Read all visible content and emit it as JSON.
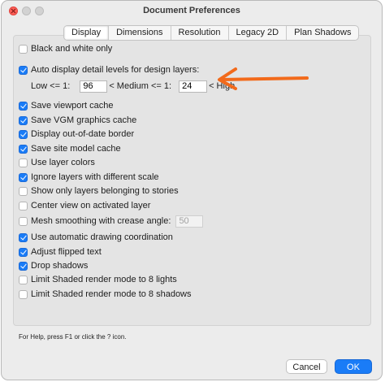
{
  "window": {
    "title": "Document Preferences"
  },
  "tabs": [
    {
      "label": "Display",
      "active": true
    },
    {
      "label": "Dimensions",
      "active": false
    },
    {
      "label": "Resolution",
      "active": false
    },
    {
      "label": "Legacy 2D",
      "active": false
    },
    {
      "label": "Plan Shadows",
      "active": false
    }
  ],
  "options": [
    {
      "label": "Black and white only",
      "checked": false
    },
    {
      "label": "Auto display detail levels for design layers:",
      "checked": true
    },
    {
      "label": "Save viewport cache",
      "checked": true
    },
    {
      "label": "Save VGM graphics cache",
      "checked": true
    },
    {
      "label": "Display out-of-date border",
      "checked": true
    },
    {
      "label": "Save site model cache",
      "checked": true
    },
    {
      "label": "Use layer colors",
      "checked": false
    },
    {
      "label": "Ignore layers with different scale",
      "checked": true
    },
    {
      "label": "Show only layers belonging to stories",
      "checked": false
    },
    {
      "label": "Center view on activated layer",
      "checked": false
    },
    {
      "label": "Mesh smoothing with crease angle:",
      "checked": false
    },
    {
      "label": "Use automatic drawing coordination",
      "checked": true
    },
    {
      "label": "Adjust flipped text",
      "checked": true
    },
    {
      "label": "Drop shadows",
      "checked": true
    },
    {
      "label": "Limit Shaded render mode to 8 lights",
      "checked": false
    },
    {
      "label": "Limit Shaded render mode to 8 shadows",
      "checked": false
    }
  ],
  "detail_levels": {
    "low_label": "Low <= 1:",
    "low_value": "96",
    "medium_label": "< Medium <= 1:",
    "medium_value": "24",
    "high_label": "< High"
  },
  "crease_angle": {
    "value": "50",
    "enabled": false
  },
  "annotation": {
    "arrow_color": "#f26a1b"
  },
  "footer": {
    "help_text": "For Help, press F1 or click the ? icon."
  },
  "buttons": {
    "cancel_label": "Cancel",
    "ok_label": "OK"
  },
  "colors": {
    "accent": "#1a7cf7"
  }
}
